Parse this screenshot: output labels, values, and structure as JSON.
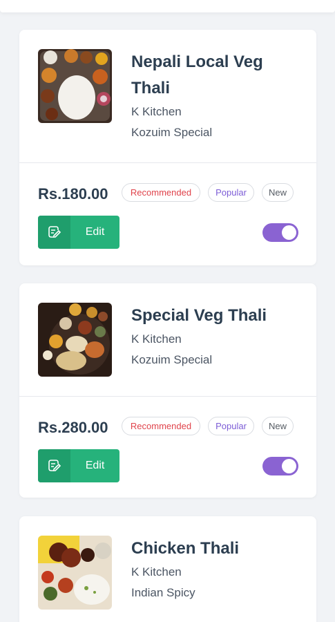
{
  "items": [
    {
      "title": "Nepali Local Veg Thali",
      "kitchen": "K Kitchen",
      "category": "Kozuim Special",
      "price": "Rs.180.00",
      "badges": [
        "Recommended",
        "Popular",
        "New"
      ],
      "edit_label": "Edit",
      "available": true,
      "image": "veg-thali-photo"
    },
    {
      "title": "Special Veg Thali",
      "kitchen": "K Kitchen",
      "category": "Kozuim Special",
      "price": "Rs.280.00",
      "badges": [
        "Recommended",
        "Popular",
        "New"
      ],
      "edit_label": "Edit",
      "available": true,
      "image": "special-thali-photo"
    },
    {
      "title": "Chicken Thali",
      "kitchen": "K Kitchen",
      "category": "Indian Spicy",
      "image": "chicken-thali-photo"
    }
  ],
  "colors": {
    "edit_green": "#26b27b",
    "toggle_purple": "#8a63d2",
    "recommended_red": "#e0434b",
    "popular_purple": "#7c5cd6",
    "title_dark": "#2c3e50"
  },
  "icons": {
    "edit": "edit-note-icon"
  }
}
